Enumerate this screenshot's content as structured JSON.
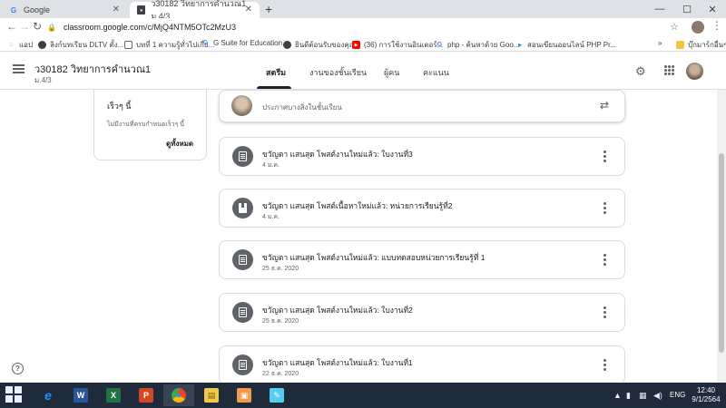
{
  "browser": {
    "tabs": [
      {
        "title": "Google",
        "icon": "google-icon",
        "active": false
      },
      {
        "title": "ว30182 วิทยาการคำนวณ1 ม.4/3",
        "icon": "classroom-icon",
        "active": true
      }
    ],
    "url": "classroom.google.com/c/MjQ4NTM5OTc2MzU3",
    "bookmarks": [
      {
        "label": "แอป",
        "icon": "apps-grid-icon"
      },
      {
        "label": "ลิงก์บทเรียน DLTV ตั้ง...",
        "icon": "globe-icon"
      },
      {
        "label": "บทที่ 1 ความรู้ทั่วไปเกี่ย...",
        "icon": "page-icon"
      },
      {
        "label": "G Suite for Education",
        "icon": "google-icon"
      },
      {
        "label": "ยินดีต้อนรับของคุณ",
        "icon": "globe-icon"
      },
      {
        "label": "(36) การใช้งานอินเตอร์...",
        "icon": "youtube-icon"
      },
      {
        "label": "php - ค้นหาด้วย Goo...",
        "icon": "google-icon"
      },
      {
        "label": "สอนเขียนออนไลน์ PHP Pr...",
        "icon": "arrow-icon"
      }
    ],
    "bookmarks_more": "»",
    "other_bookmarks": "บุ๊กมาร์กอื่นๆ"
  },
  "classroom": {
    "class_title": "ว30182 วิทยาการคำนวณ1",
    "class_section": "ม.4/3",
    "tabs": [
      "สตรีม",
      "งานของชั้นเรียน",
      "ผู้คน",
      "คะแนน"
    ],
    "active_tab": "สตรีม"
  },
  "upcoming": {
    "title": "เร็วๆ นี้",
    "empty_text": "ไม่มีงานที่ครบกำหนดเร็วๆ นี้",
    "view_all": "ดูทั้งหมด"
  },
  "announce": {
    "placeholder": "ประกาศบางสิ่งในชั้นเรียน"
  },
  "posts": [
    {
      "title": "ขวัญตา แสนสุด โพสต์งานใหม่แล้ว: ใบงานที่3",
      "date": "4 ม.ค.",
      "icon": "assignment-icon"
    },
    {
      "title": "ขวัญตา แสนสุด โพสต์เนื้อหาใหม่แล้ว: หน่วยการเรียนรู้ที่2",
      "date": "4 ม.ค.",
      "icon": "material-icon"
    },
    {
      "title": "ขวัญตา แสนสุด โพสต์งานใหม่แล้ว: แบบทดสอบหน่วยการเรียนรู้ที่ 1",
      "date": "25 ธ.ค. 2020",
      "icon": "assignment-icon"
    },
    {
      "title": "ขวัญตา แสนสุด โพสต์งานใหม่แล้ว: ใบงานที่2",
      "date": "25 ธ.ค. 2020",
      "icon": "assignment-icon"
    },
    {
      "title": "ขวัญตา แสนสุด โพสต์งานใหม่แล้ว: ใบงานที่1",
      "date": "22 ธ.ค. 2020",
      "icon": "assignment-icon"
    }
  ],
  "taskbar": {
    "apps": [
      {
        "name": "internet-explorer-icon",
        "glyph": "e",
        "color": "#1e90ff"
      },
      {
        "name": "word-icon",
        "glyph": "W",
        "color": "#2b579a"
      },
      {
        "name": "excel-icon",
        "glyph": "X",
        "color": "#217346"
      },
      {
        "name": "powerpoint-icon",
        "glyph": "P",
        "color": "#d24726"
      },
      {
        "name": "chrome-icon",
        "glyph": "●",
        "color": "#4285f4"
      },
      {
        "name": "file-explorer-icon",
        "glyph": "▤",
        "color": "#f2c94c"
      },
      {
        "name": "photos-icon",
        "glyph": "▣",
        "color": "#f2994a"
      },
      {
        "name": "paint-icon",
        "glyph": "✎",
        "color": "#56ccf2"
      }
    ],
    "language": "ENG",
    "time": "12:40",
    "date": "9/1/2564"
  }
}
